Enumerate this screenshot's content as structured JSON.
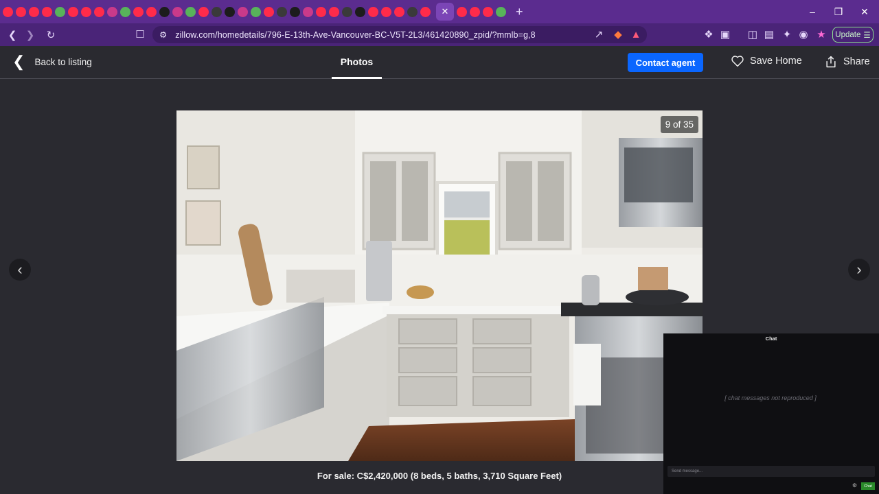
{
  "browser": {
    "url": "zillow.com/homedetails/796-E-13th-Ave-Vancouver-BC-V5T-2L3/461420890_zpid/?mmlb=g,8",
    "update_label": "Update",
    "active_tab_close": "✕",
    "new_tab": "+"
  },
  "header": {
    "back_label": "Back to listing",
    "photos_tab": "Photos",
    "contact_label": "Contact agent",
    "save_label": "Save Home",
    "share_label": "Share"
  },
  "photo": {
    "counter": "9 of 35",
    "caption": "For sale: C$2,420,000 (8 beds, 5 baths, 3,710 Square Feet)"
  },
  "chat": {
    "title": "Chat",
    "input_placeholder": "Send message...",
    "send_label": "Chat"
  },
  "colors": {
    "tabstrip": "#5b2c8f",
    "toolbar": "#4a2478",
    "page_bg": "#2a2a30",
    "contact_button": "#0a66ff"
  }
}
